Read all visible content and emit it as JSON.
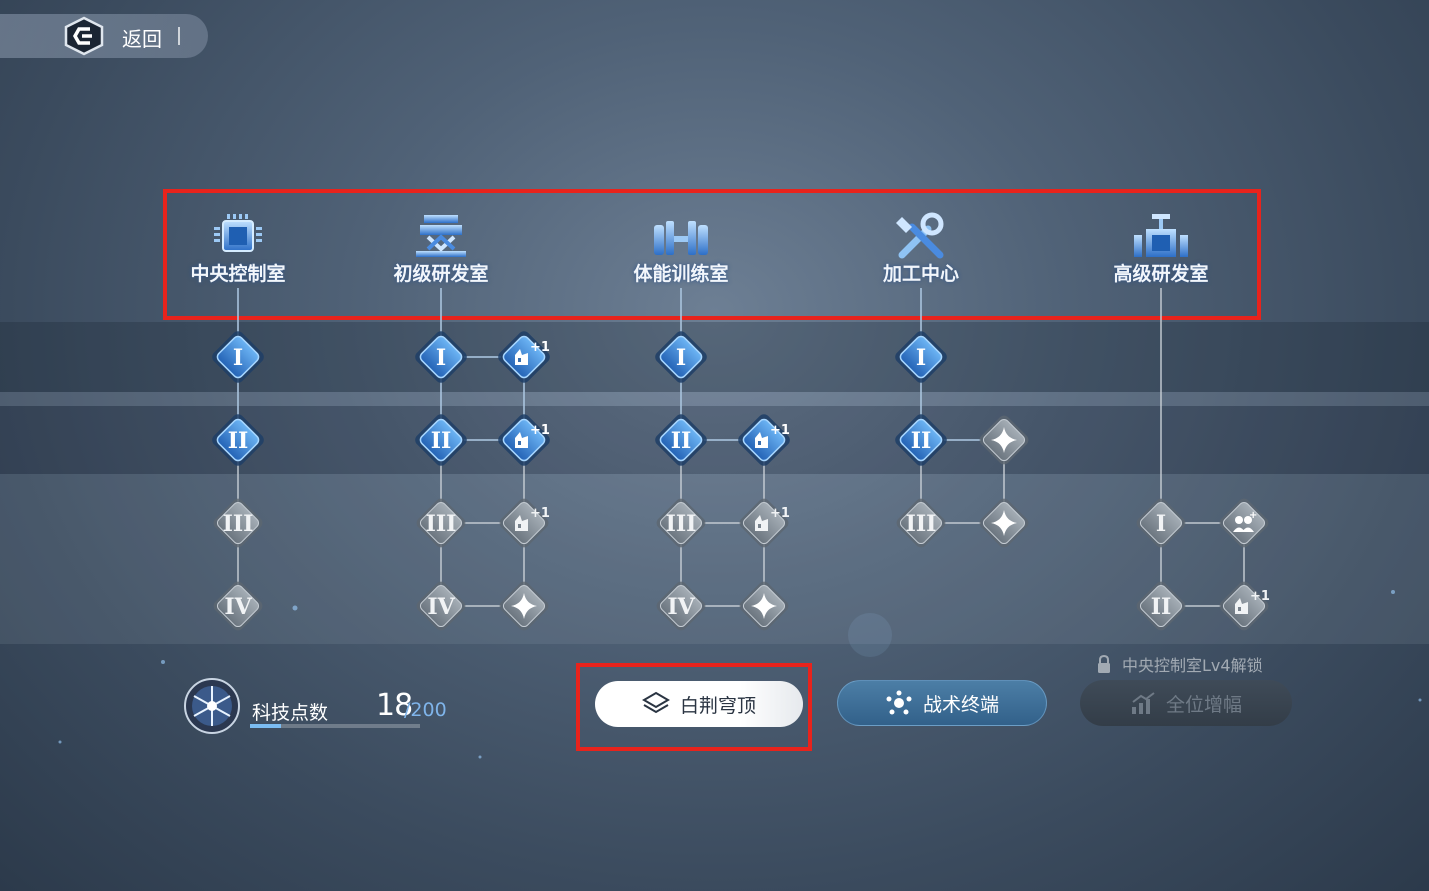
{
  "header": {
    "back_label": "返回"
  },
  "columns": [
    {
      "title": "中央控制室",
      "icon": "cpu-icon",
      "nodes": [
        {
          "label": "I",
          "active": true
        },
        {
          "label": "II",
          "active": true
        },
        {
          "label": "III",
          "active": false
        },
        {
          "label": "IV",
          "active": false
        }
      ],
      "side_nodes": []
    },
    {
      "title": "初级研发室",
      "icon": "research-lab-icon",
      "nodes": [
        {
          "label": "I",
          "active": true
        },
        {
          "label": "II",
          "active": true
        },
        {
          "label": "III",
          "active": false
        },
        {
          "label": "IV",
          "active": false
        }
      ],
      "side_nodes": [
        {
          "icon": "building-plus-icon",
          "badge": "+1",
          "active": true
        },
        {
          "icon": "building-plus-icon",
          "badge": "+1",
          "active": true
        },
        {
          "icon": "building-plus-icon",
          "badge": "+1",
          "active": false
        },
        {
          "icon": "star-icon",
          "active": false
        }
      ]
    },
    {
      "title": "体能训练室",
      "icon": "dumbbell-icon",
      "nodes": [
        {
          "label": "I",
          "active": true
        },
        {
          "label": "II",
          "active": true
        },
        {
          "label": "III",
          "active": false
        },
        {
          "label": "IV",
          "active": false
        }
      ],
      "side_nodes": [
        null,
        {
          "icon": "building-plus-icon",
          "badge": "+1",
          "active": true
        },
        {
          "icon": "building-plus-icon",
          "badge": "+1",
          "active": false
        },
        {
          "icon": "star-icon",
          "active": false
        }
      ]
    },
    {
      "title": "加工中心",
      "icon": "wrench-icon",
      "nodes": [
        {
          "label": "I",
          "active": true
        },
        {
          "label": "II",
          "active": true
        },
        {
          "label": "III",
          "active": false
        }
      ],
      "side_nodes": [
        null,
        {
          "icon": "star-icon",
          "active": false
        },
        {
          "icon": "star-icon",
          "active": false
        }
      ]
    },
    {
      "title": "高级研发室",
      "icon": "advanced-lab-icon",
      "nodes": [
        null,
        null,
        {
          "label": "I",
          "active": false
        },
        {
          "label": "II",
          "active": false
        }
      ],
      "side_nodes": [
        null,
        null,
        {
          "icon": "team-plus-icon",
          "active": false
        },
        {
          "icon": "building-plus-icon",
          "badge": "+1",
          "active": false
        }
      ]
    }
  ],
  "tech_points": {
    "label": "科技点数",
    "value": "18",
    "max": "/200",
    "fraction": 0.09
  },
  "buttons": {
    "white": {
      "label": "白荆穹顶",
      "icon": "layers-icon"
    },
    "blue": {
      "label": "战术终端",
      "icon": "network-icon"
    },
    "locked": {
      "label": "全位增幅",
      "icon": "chart-up-icon",
      "note": "中央控制室Lv4解锁"
    }
  },
  "colors": {
    "active_fill": "#3f8fd6",
    "inactive_fill": "#8a959f",
    "highlight": "#e8231c",
    "accent": "#7bbcf2"
  }
}
